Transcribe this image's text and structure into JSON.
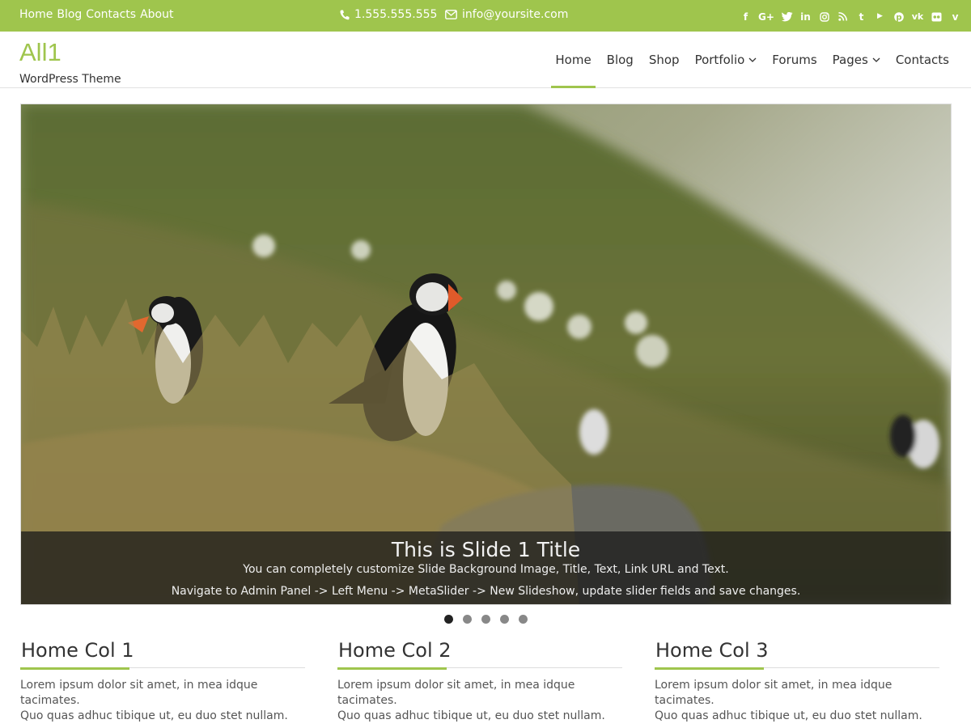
{
  "topbar": {
    "links": [
      "Home",
      "Blog",
      "Contacts",
      "About"
    ],
    "phone": "1.555.555.555",
    "email": "info@yoursite.com",
    "social": [
      "facebook-icon",
      "google-plus-icon",
      "twitter-icon",
      "linkedin-icon",
      "instagram-icon",
      "rss-icon",
      "tumblr-icon",
      "youtube-icon",
      "pinterest-icon",
      "vk-icon",
      "flickr-icon",
      "vine-icon"
    ]
  },
  "header": {
    "logo": "All1",
    "tagline": "WordPress Theme"
  },
  "nav": {
    "items": [
      {
        "label": "Home"
      },
      {
        "label": "Blog"
      },
      {
        "label": "Shop"
      },
      {
        "label": "Portfolio"
      },
      {
        "label": "Forums"
      },
      {
        "label": "Pages"
      },
      {
        "label": "Contacts"
      }
    ]
  },
  "slider": {
    "title": "This is Slide 1 Title",
    "text1": "You can completely customize Slide Background Image, Title, Text, Link URL and Text.",
    "text2": "Navigate to Admin Panel -> Left Menu -> MetaSlider -> New Slideshow, update slider fields and save changes.",
    "slide_count": 5,
    "active_slide": 1
  },
  "columns": [
    {
      "title": "Home Col 1",
      "line1": "Lorem ipsum dolor sit amet, in mea idque tacimates.",
      "line2": "Quo quas adhuc tibique ut, eu duo stet nullam."
    },
    {
      "title": "Home Col 2",
      "line1": "Lorem ipsum dolor sit amet, in mea idque tacimates.",
      "line2": "Quo quas adhuc tibique ut, eu duo stet nullam."
    },
    {
      "title": "Home Col 3",
      "line1": "Lorem ipsum dolor sit amet, in mea idque tacimates.",
      "line2": "Quo quas adhuc tibique ut, eu duo stet nullam."
    }
  ],
  "colors": {
    "accent": "#9fc54d"
  }
}
